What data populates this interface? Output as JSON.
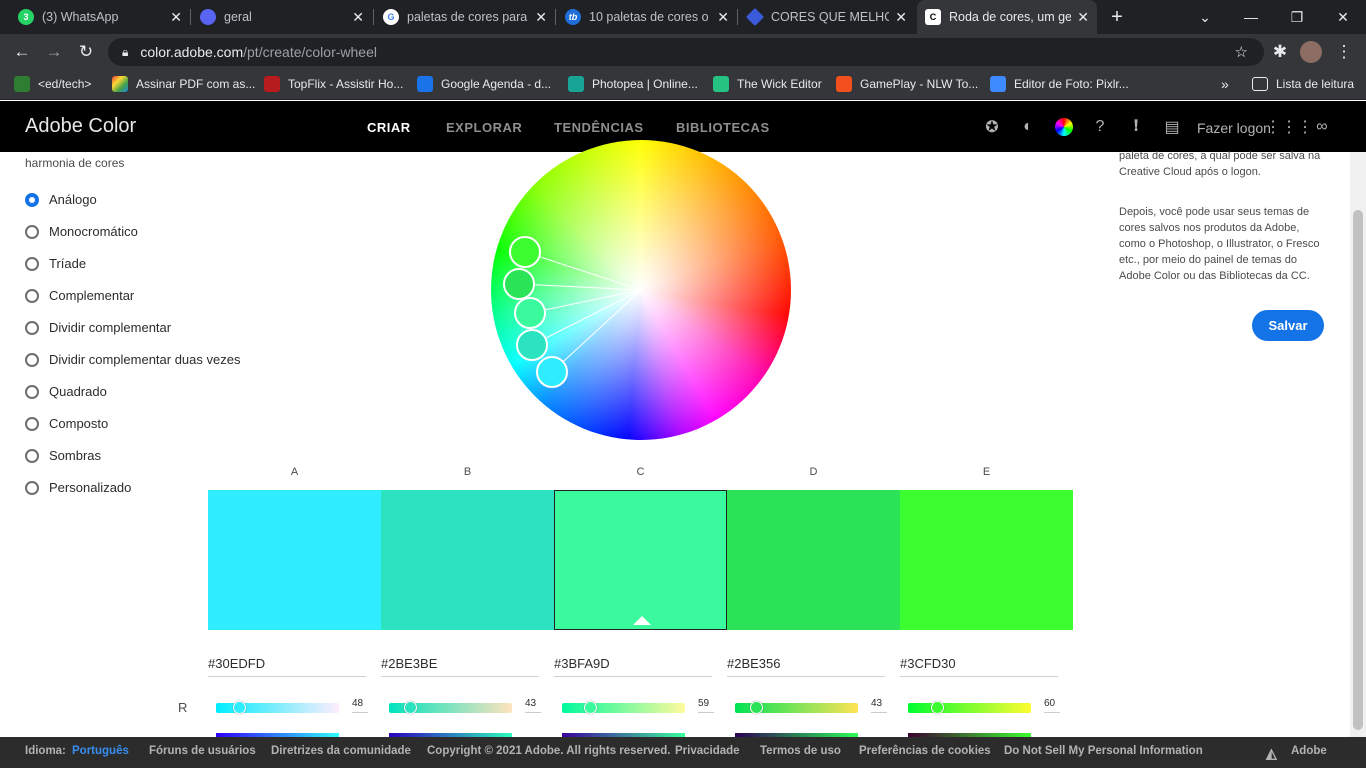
{
  "browser": {
    "tabs": [
      {
        "title": "(3) WhatsApp",
        "icon": "whatsapp-icon",
        "color": "#25d366",
        "badge": "3"
      },
      {
        "title": "geral",
        "icon": "discord-icon",
        "color": "#5865f2",
        "badge": ""
      },
      {
        "title": "paletas de cores para",
        "icon": "google-icon",
        "color": "#4285f4",
        "badge": ""
      },
      {
        "title": "10 paletas de cores o",
        "icon": "tb-icon",
        "color": "#1e6fd9",
        "badge": "tb"
      },
      {
        "title": "CORES QUE MELHORA",
        "icon": "diamond-icon",
        "color": "#3b5bdb",
        "badge": ""
      },
      {
        "title": "Roda de cores, um ge",
        "icon": "adobe-color-icon",
        "color": "#1a1a1a",
        "badge": ""
      }
    ],
    "url_host": "color.adobe.com",
    "url_path": "/pt/create/color-wheel",
    "bookmarks": [
      {
        "label": "<ed/tech>",
        "color": "#2e7d32"
      },
      {
        "label": "Assinar PDF com as...",
        "color": "#e53935"
      },
      {
        "label": "TopFlix - Assistir Ho...",
        "color": "#b71c1c"
      },
      {
        "label": "Google Agenda - d...",
        "color": "#1a73e8"
      },
      {
        "label": "Photopea | Online...",
        "color": "#18a497"
      },
      {
        "label": "The Wick Editor",
        "color": "#26c281"
      },
      {
        "label": "GamePlay - NLW To...",
        "color": "#f24e1e"
      },
      {
        "label": "Editor de Foto: Pixlr...",
        "color": "#3d8bfd"
      }
    ],
    "more_bookmarks": "»",
    "reading_list": "Lista de leitura"
  },
  "header": {
    "brand": "Adobe Color",
    "nav": [
      "CRIAR",
      "EXPLORAR",
      "TENDÊNCIAS",
      "BIBLIOTECAS"
    ],
    "login": "Fazer logon"
  },
  "left": {
    "partial_text": "harmonia de cores",
    "options": [
      "Análogo",
      "Monocromático",
      "Tríade",
      "Complementar",
      "Dividir complementar",
      "Dividir complementar duas vezes",
      "Quadrado",
      "Composto",
      "Sombras",
      "Personalizado"
    ],
    "selected": "Análogo"
  },
  "right": {
    "text1_line1": "paleta de cores, a qual pode ser salva na",
    "text1_line2": "Creative Cloud após o logon.",
    "text2_lines": [
      "Depois, você pode usar seus temas de",
      "cores salvos nos produtos da Adobe,",
      "como o Photoshop, o Illustrator, o Fresco",
      "etc., por meio do painel de temas do",
      "Adobe Color ou das Bibliotecas da CC."
    ],
    "save_label": "Salvar"
  },
  "palette": {
    "labels": [
      "A",
      "B",
      "C",
      "D",
      "E"
    ],
    "colors": [
      "#30EDFD",
      "#2BE3BE",
      "#3BFA9D",
      "#2BE356",
      "#3CFD30"
    ],
    "hex": [
      "#30EDFD",
      "#2BE3BE",
      "#3BFA9D",
      "#2BE356",
      "#3CFD30"
    ],
    "selected_index": 2,
    "r_label": "R",
    "r_values": [
      "48",
      "43",
      "59",
      "43",
      "60"
    ],
    "r_fractions": [
      0.188,
      0.169,
      0.231,
      0.169,
      0.235
    ]
  },
  "footer": {
    "language_label": "Idioma:",
    "language": "Português",
    "links": [
      "Fóruns de usuários",
      "Diretrizes da comunidade",
      "Copyright © 2021 Adobe. All rights reserved.",
      "Privacidade",
      "Termos de uso",
      "Preferências de cookies",
      "Do Not Sell My Personal Information"
    ],
    "adobe": "Adobe"
  }
}
